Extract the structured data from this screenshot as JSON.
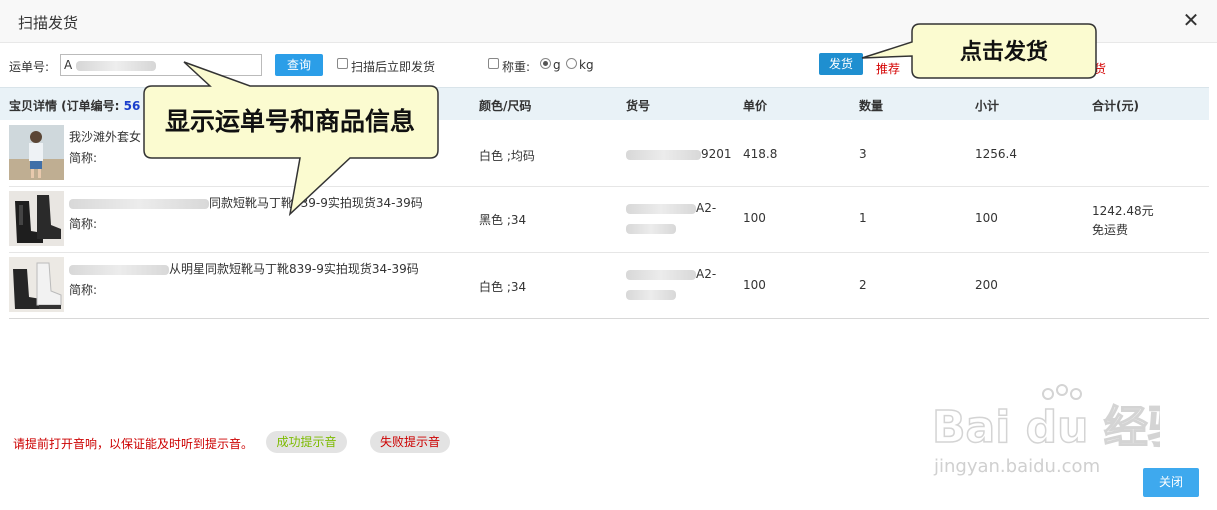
{
  "dialog": {
    "title": "扫描发货"
  },
  "toolbar": {
    "waybill_label": "运单号:",
    "waybill_value": "A",
    "query_button": "查询",
    "scan_auto_ship_label": "扫描后立即发货",
    "weigh_label": "称重:",
    "unit_g": "g",
    "unit_kg": "kg",
    "ship_button": "发货",
    "red_status_left": "推荐",
    "red_status_right": "货"
  },
  "table": {
    "headers": {
      "item": "宝贝详情 (订单编号:",
      "order_no": "56",
      "color_size": "颜色/尺码",
      "sku": "货号",
      "price": "单价",
      "qty": "数量",
      "subtotal": "小计",
      "total": "合计(元)"
    },
    "rows": [
      {
        "title": "我沙滩外套女",
        "short_name_label": "简称:",
        "color_size": "白色 ;均码",
        "sku": "9201",
        "price": "418.8",
        "qty": "3",
        "subtotal": "1256.4"
      },
      {
        "title": "同款短靴马丁靴839-9实拍现货34-39码",
        "short_name_label": "简称:",
        "color_size": "黑色 ;34",
        "sku": "A2-",
        "price": "100",
        "qty": "1",
        "subtotal": "100"
      },
      {
        "title": "从明星同款短靴马丁靴839-9实拍现货34-39码",
        "short_name_label": "简称:",
        "color_size": "白色 ;34",
        "sku": "A2-",
        "price": "100",
        "qty": "2",
        "subtotal": "200"
      }
    ],
    "total_amount": "1242.48元",
    "shipping_note": "免运费"
  },
  "footer": {
    "warning": "请提前打开音响，以保证能及时听到提示音。",
    "success_sound": "成功提示音",
    "fail_sound": "失败提示音",
    "close_button": "关闭"
  },
  "callouts": {
    "ship_hint": "点击发货",
    "info_hint": "显示运单号和商品信息"
  },
  "watermark": {
    "brand": "Bai du 经验",
    "url": "jingyan.baidu.com"
  },
  "colors": {
    "accent_blue": "#2b9ee8",
    "ship_button": "#1f8fd0",
    "warning_red": "#cc0000",
    "success_green": "#7dbb00",
    "callout_fill": "#fbfbd0"
  }
}
